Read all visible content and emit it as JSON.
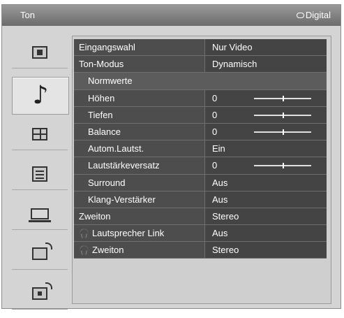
{
  "window": {
    "title": "Ton",
    "source_label": "Digital"
  },
  "sidebar": {
    "items": [
      {
        "icon": "picture-icon"
      },
      {
        "icon": "music-note-icon",
        "glyph": "♪",
        "active": true
      },
      {
        "icon": "screen-format-icon"
      },
      {
        "icon": "settings-list-icon"
      },
      {
        "icon": "pc-monitor-icon"
      },
      {
        "icon": "network-icon"
      },
      {
        "icon": "network-media-icon"
      }
    ]
  },
  "menu": {
    "rows": [
      {
        "label": "Eingangswahl",
        "value": "Nur Video"
      },
      {
        "label": "Ton-Modus",
        "value": "Dynamisch"
      },
      {
        "label": "Normwerte",
        "value": ""
      },
      {
        "label": "Höhen",
        "value": "0",
        "slider": 0.5
      },
      {
        "label": "Tiefen",
        "value": "0",
        "slider": 0.5
      },
      {
        "label": "Balance",
        "value": "0",
        "slider": 0.5
      },
      {
        "label": "Autom.Lautst.",
        "value": "Ein"
      },
      {
        "label": "Lautstärkeversatz",
        "value": "0",
        "slider": 0.5
      },
      {
        "label": "Surround",
        "value": "Aus"
      },
      {
        "label": "Klang-Verstärker",
        "value": "Aus"
      },
      {
        "label": "Zweiton",
        "value": "Stereo"
      },
      {
        "label": "Lautsprecher Link",
        "value": "Aus",
        "headphone_glyph": "🎧"
      },
      {
        "label": "Zweiton",
        "value": "Stereo",
        "headphone_glyph": "🎧"
      }
    ]
  }
}
